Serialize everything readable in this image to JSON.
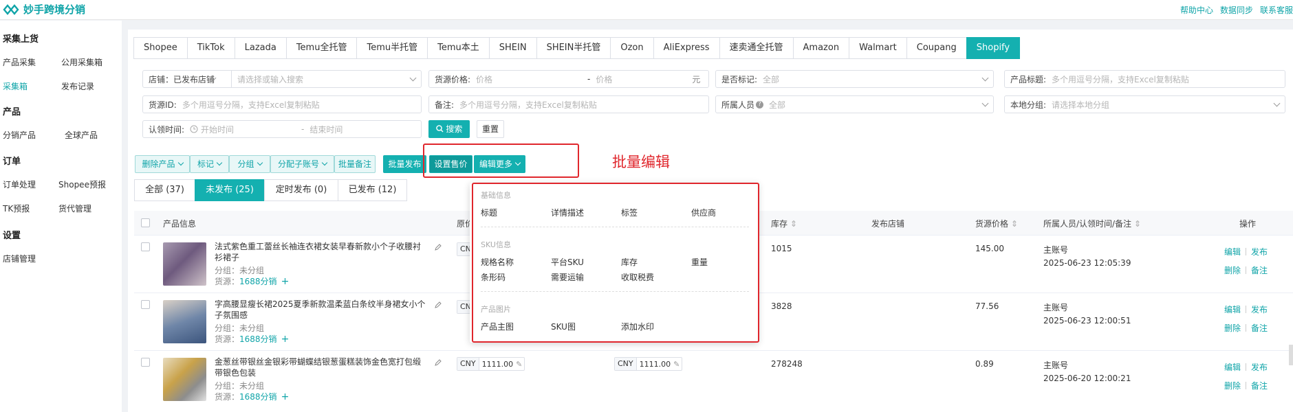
{
  "app": {
    "name": "妙手跨境分销",
    "top_links": [
      "帮助中心",
      "数据同步",
      "联系客服"
    ],
    "brand_color": "#14b0b0"
  },
  "sidebar": {
    "sections": [
      {
        "title": "采集上货",
        "items": [
          "产品采集",
          "公用采集箱",
          "采集箱",
          "发布记录"
        ]
      },
      {
        "title": "产品",
        "items": [
          "分销产品",
          "全球产品"
        ]
      },
      {
        "title": "订单",
        "items": [
          "订单处理",
          "Shopee预报",
          "TK预报",
          "货代管理"
        ]
      },
      {
        "title": "设置",
        "items": [
          "店铺管理"
        ]
      }
    ],
    "active_item": "采集箱"
  },
  "platform_tabs": [
    "Shopee",
    "TikTok",
    "Lazada",
    "Temu全托管",
    "Temu半托管",
    "Temu本土",
    "SHEIN",
    "SHEIN半托管",
    "Ozon",
    "AliExpress",
    "速卖通全托管",
    "Amazon",
    "Walmart",
    "Coupang",
    "Shopify"
  ],
  "active_platform": "Shopify",
  "filters": {
    "store_label": "店铺：已发布店铺",
    "store_ph": "请选择或输入搜索",
    "price_label": "货源价格:",
    "price_min_ph": "价格",
    "price_dash": "-",
    "price_max_ph": "价格",
    "price_unit": "元",
    "marked_label": "是否标记:",
    "marked_value": "全部",
    "title_label": "产品标题:",
    "title_ph": "多个用逗号分隔，支持Excel复制粘贴",
    "source_id_label": "货源ID:",
    "source_id_ph": "多个用逗号分隔，支持Excel复制粘贴",
    "remark_label": "备注:",
    "remark_ph": "多个用逗号分隔，支持Excel复制粘贴",
    "owner_label": "所属人员",
    "owner_value": "全部",
    "group_label": "本地分组:",
    "group_ph": "请选择本地分组",
    "claim_label": "认领时间:",
    "claim_start_ph": "开始时间",
    "claim_dash": "-",
    "claim_end_ph": "结束时间",
    "search_btn": "搜索",
    "reset_btn": "重置"
  },
  "actions": {
    "delete": "删除产品",
    "mark": "标记",
    "group": "分组",
    "assign": "分配子账号",
    "batch_remark": "批量备注",
    "batch_publish": "批量发布",
    "set_price": "设置售价",
    "edit_more": "编辑更多"
  },
  "annotation": "批量编辑",
  "status_tabs": [
    "全部 (37)",
    "未发布 (25)",
    "定时发布 (0)",
    "已发布 (12)"
  ],
  "active_status": "未发布 (25)",
  "table": {
    "headers": {
      "product": "产品信息",
      "price": "原价",
      "stock": "库存",
      "store": "发布店铺",
      "source_price": "货源价格",
      "owner": "所属人员/认领时间/备注",
      "ops": "操作"
    },
    "rows": [
      {
        "title": "法式紫色重工蕾丝长袖连衣裙女装早春新款小个子收腰衬衫裙子",
        "group": "分组：未分组",
        "source_label": "货源：",
        "source": "1688分销",
        "stock": "1015",
        "source_price": "145.00",
        "owner": "主账号",
        "time": "2025-06-23 12:05:39"
      },
      {
        "title": "字高腰显瘦长裙2025夏季新款温柔蓝白条纹半身裙女小个子氛围感",
        "group": "分组：未分组",
        "source_label": "货源：",
        "source": "1688分销",
        "stock": "3828",
        "source_price": "77.56",
        "owner": "主账号",
        "time": "2025-06-23 12:00:51"
      },
      {
        "title": "金葱丝带银丝金银彩带蝴蝶结银葱蛋糕装饰金色宽打包缎带银色包装",
        "group": "分组：未分组",
        "source_label": "货源：",
        "source": "1688分销",
        "stock": "278248",
        "source_price": "0.89",
        "owner": "主账号",
        "time": "2025-06-20 12:00:21",
        "currency": "CNY",
        "price": "1111.00",
        "price2": "1111.00"
      }
    ],
    "ops": {
      "edit": "编辑",
      "publish": "发布",
      "delete": "删除",
      "remark": "备注"
    },
    "currency_short": "CNY"
  },
  "dropdown": {
    "basic_title": "基础信息",
    "basic_items": [
      "标题",
      "详情描述",
      "标签",
      "供应商"
    ],
    "sku_title": "SKU信息",
    "sku_items": [
      "规格名称",
      "平台SKU",
      "库存",
      "重量",
      "条形码",
      "需要运输",
      "收取税费"
    ],
    "img_title": "产品图片",
    "img_items": [
      "产品主图",
      "SKU图",
      "添加水印"
    ]
  }
}
